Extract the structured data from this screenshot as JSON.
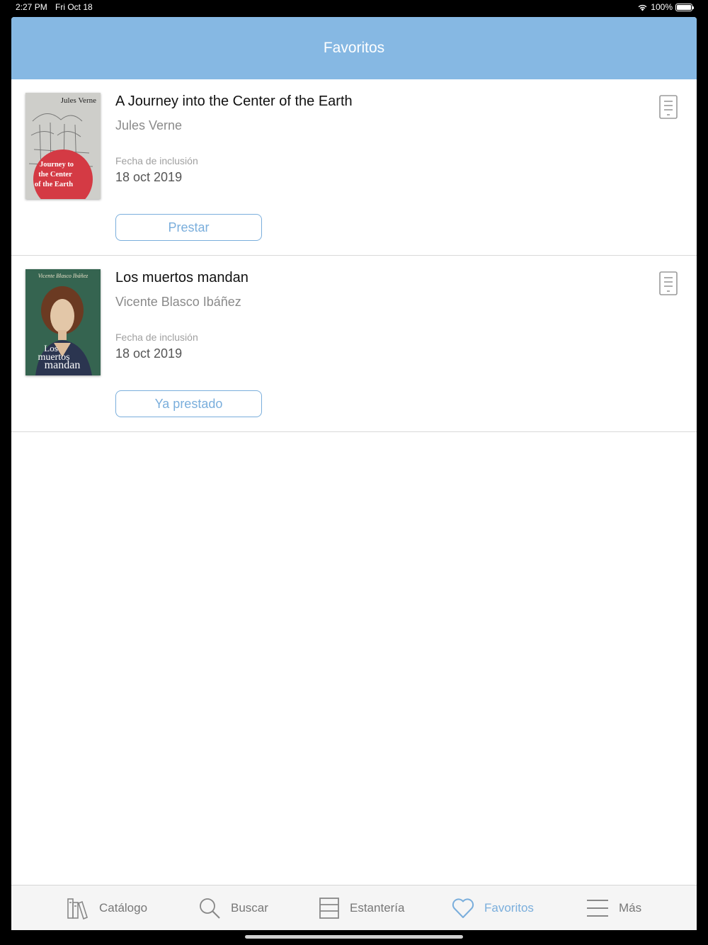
{
  "status_bar": {
    "time": "2:27 PM",
    "date": "Fri Oct 18",
    "battery": "100%"
  },
  "header": {
    "title": "Favoritos"
  },
  "books": [
    {
      "title": "A Journey into the Center of the Earth",
      "author": "Jules Verne",
      "date_label": "Fecha de inclusión",
      "date_value": "18 oct 2019",
      "action_label": "Prestar",
      "cover": {
        "author_text": "Jules Verne",
        "title_lines": [
          "Journey to",
          "the Center",
          "of the Earth"
        ]
      }
    },
    {
      "title": "Los muertos mandan",
      "author": "Vicente Blasco Ibáñez",
      "date_label": "Fecha de inclusión",
      "date_value": "18 oct 2019",
      "action_label": "Ya prestado",
      "cover": {
        "author_text": "Vicente Blasco Ibáñez",
        "title_lines": [
          "Los",
          "muertos",
          "mandan"
        ]
      }
    }
  ],
  "tabs": [
    {
      "label": "Catálogo",
      "icon": "books-icon",
      "active": false
    },
    {
      "label": "Buscar",
      "icon": "search-icon",
      "active": false
    },
    {
      "label": "Estantería",
      "icon": "shelf-icon",
      "active": false
    },
    {
      "label": "Favoritos",
      "icon": "heart-icon",
      "active": true
    },
    {
      "label": "Más",
      "icon": "menu-icon",
      "active": false
    }
  ],
  "colors": {
    "accent": "#7aaedc",
    "header": "#86b8e3"
  }
}
